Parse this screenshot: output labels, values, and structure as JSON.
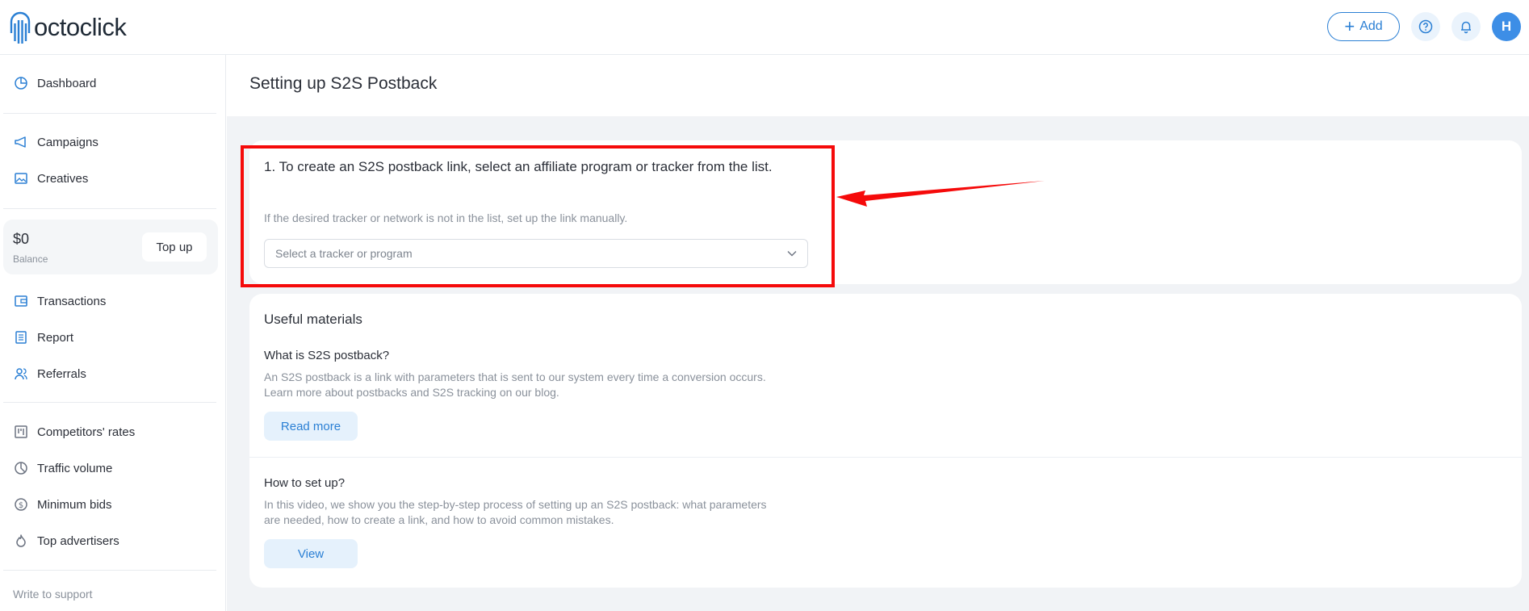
{
  "header": {
    "logo_text": "octoclick",
    "add_label": "Add",
    "avatar_initial": "H",
    "accent_color": "#2a7fd4"
  },
  "sidebar": {
    "items": [
      {
        "label": "Dashboard",
        "icon": "pie-chart-icon"
      },
      {
        "label": "Campaigns",
        "icon": "megaphone-icon"
      },
      {
        "label": "Creatives",
        "icon": "image-icon"
      },
      {
        "label": "Transactions",
        "icon": "wallet-icon"
      },
      {
        "label": "Report",
        "icon": "report-icon"
      },
      {
        "label": "Referrals",
        "icon": "users-icon"
      },
      {
        "label": "Competitors' rates",
        "icon": "bars-icon"
      },
      {
        "label": "Traffic volume",
        "icon": "pie-icon"
      },
      {
        "label": "Minimum bids",
        "icon": "dollar-icon"
      },
      {
        "label": "Top advertisers",
        "icon": "flame-icon"
      }
    ],
    "balance": {
      "amount": "$0",
      "label": "Balance",
      "topup_label": "Top up"
    },
    "support_label": "Write to support"
  },
  "main": {
    "title": "Setting up S2S Postback",
    "step1": {
      "text": "1. To create an S2S postback link, select an affiliate program or tracker from the list.",
      "hint": "If the desired tracker or network is not in the list, set up the link manually.",
      "select_placeholder": "Select a tracker or program"
    },
    "materials": {
      "heading": "Useful materials",
      "items": [
        {
          "question": "What is S2S postback?",
          "line1": "An S2S postback is a link with parameters that is sent to our system every time a conversion occurs.",
          "line2": "Learn more about postbacks and S2S tracking on our blog.",
          "button": "Read more"
        },
        {
          "question": "How to set up?",
          "line1": "In this video, we show you the step-by-step process of setting up an S2S postback: what parameters",
          "line2": "are needed, how to create a link, and how to avoid common mistakes.",
          "button": "View"
        }
      ]
    }
  },
  "annotation": {
    "color": "#f50a0a"
  }
}
